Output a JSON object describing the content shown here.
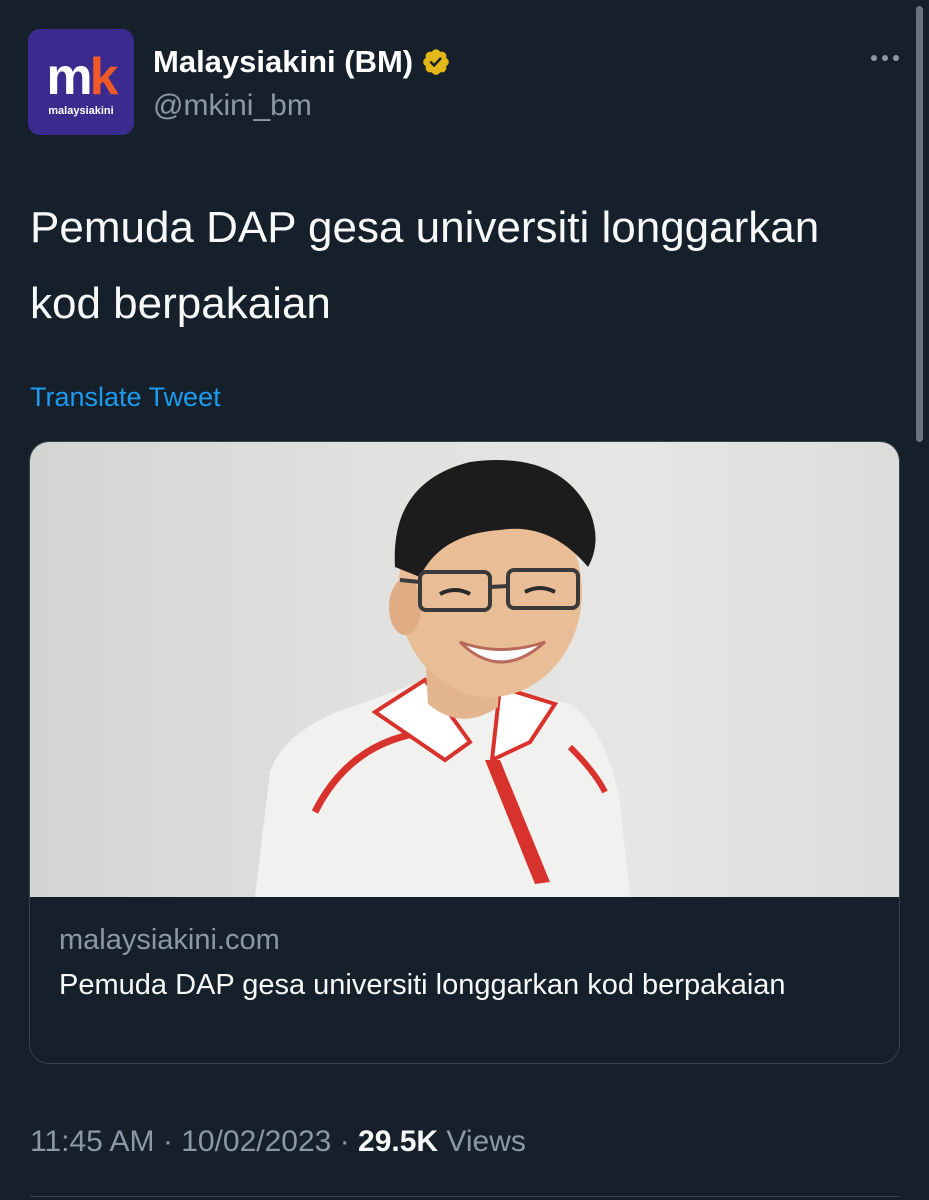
{
  "account": {
    "avatar_text_m": "m",
    "avatar_text_k": "k",
    "avatar_sub": "malaysiakini",
    "display_name": "Malaysiakini (BM)",
    "handle": "@mkini_bm",
    "verified_color": "#e2b719"
  },
  "tweet": {
    "text": "Pemuda DAP gesa universiti longgarkan kod berpakaian",
    "translate_label": "Translate Tweet"
  },
  "card": {
    "image_icon": "person-photo",
    "domain": "malaysiakini.com",
    "title": "Pemuda DAP gesa universiti longgarkan kod berpakaian"
  },
  "meta": {
    "time": "11:45 AM",
    "sep1": " · ",
    "date": "10/02/2023",
    "sep2": " · ",
    "views_count": "29.5K",
    "views_label": " Views"
  },
  "colors": {
    "background": "#15202b",
    "link": "#1d9bf0",
    "secondary_text": "#8b98a5",
    "avatar_bg": "#3b2b8f",
    "avatar_accent": "#f05a28"
  }
}
